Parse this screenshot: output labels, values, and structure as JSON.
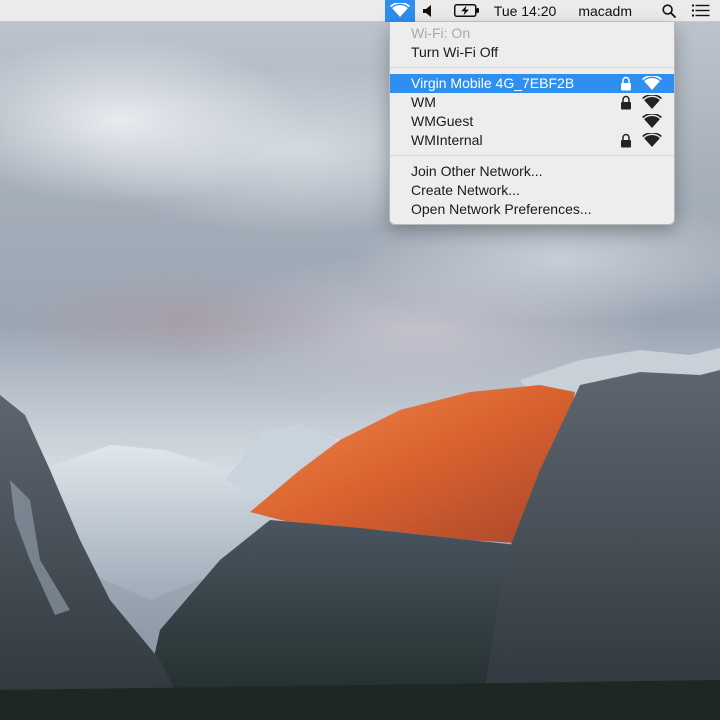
{
  "menubar": {
    "wifi_icon": "wifi-icon",
    "volume_icon": "speaker-icon",
    "battery_icon": "battery-charging-icon",
    "clock": "Tue 14:20",
    "user": "macadm",
    "search_icon": "search-icon",
    "notification_icon": "list-icon",
    "accent": "#2d8ef0"
  },
  "wifi_menu": {
    "status": "Wi-Fi: On",
    "toggle": "Turn Wi-Fi Off",
    "networks": [
      {
        "name": "Virgin Mobile 4G_7EBF2B",
        "locked": true,
        "selected": true
      },
      {
        "name": "WM",
        "locked": true,
        "selected": false
      },
      {
        "name": "WMGuest",
        "locked": false,
        "selected": false
      },
      {
        "name": "WMInternal",
        "locked": true,
        "selected": false
      }
    ],
    "join_other": "Join Other Network...",
    "create": "Create Network...",
    "preferences": "Open Network Preferences..."
  }
}
